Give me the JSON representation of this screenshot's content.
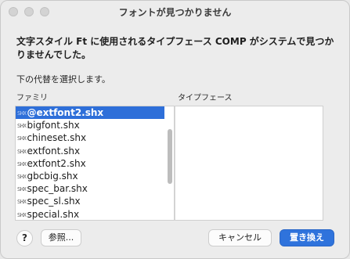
{
  "window": {
    "title": "フォントが見つかりません"
  },
  "message": "文字スタイル Ft に使用されるタイプフェース COMP がシステムで見つかりませんでした。",
  "instruction": "下の代替を選択します。",
  "columns": {
    "family_label": "ファミリ",
    "typeface_label": "タイプフェース"
  },
  "family_list": {
    "items": [
      {
        "badge": "SHX",
        "name": "@extfont2.shx",
        "selected": true
      },
      {
        "badge": "SHX",
        "name": "bigfont.shx",
        "selected": false
      },
      {
        "badge": "SHX",
        "name": "chineset.shx",
        "selected": false
      },
      {
        "badge": "SHX",
        "name": "extfont.shx",
        "selected": false
      },
      {
        "badge": "SHX",
        "name": "extfont2.shx",
        "selected": false
      },
      {
        "badge": "SHX",
        "name": "gbcbig.shx",
        "selected": false
      },
      {
        "badge": "SHX",
        "name": "spec_bar.shx",
        "selected": false
      },
      {
        "badge": "SHX",
        "name": "spec_sl.shx",
        "selected": false
      },
      {
        "badge": "SHX",
        "name": "special.shx",
        "selected": false
      }
    ]
  },
  "buttons": {
    "help": "?",
    "browse": "参照...",
    "cancel": "キャンセル",
    "replace": "置き換え"
  },
  "colors": {
    "selection": "#2e6fd9",
    "primary_button": "#2f73dc"
  }
}
